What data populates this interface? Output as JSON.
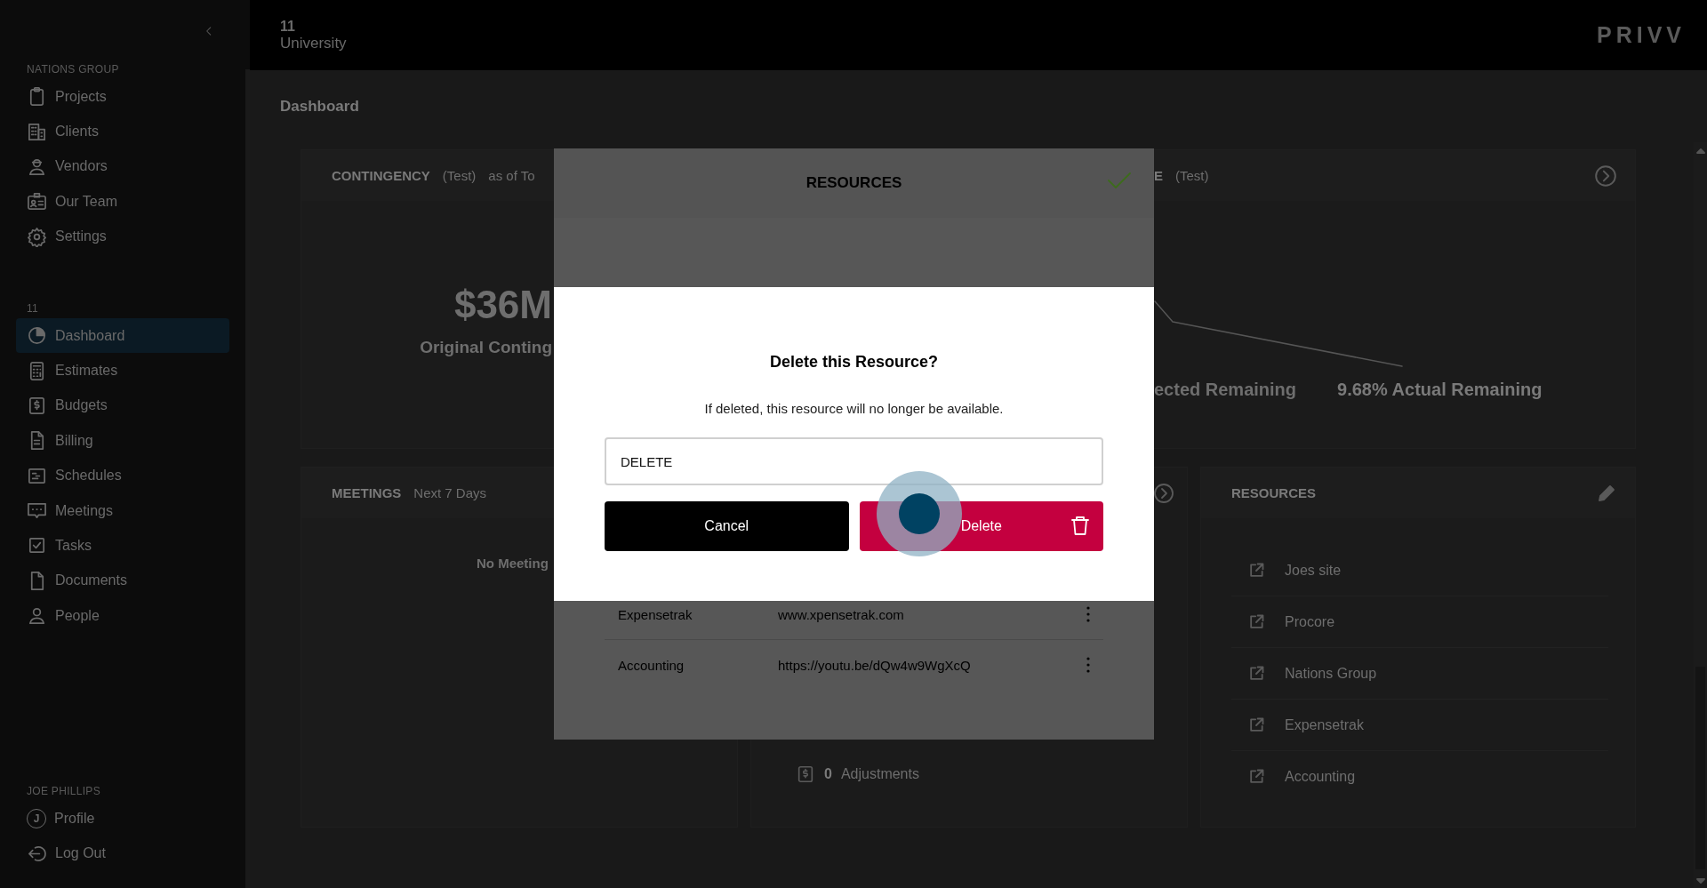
{
  "sidebar": {
    "sections": [
      {
        "title": "NATIONS GROUP",
        "items": [
          {
            "label": "Projects",
            "selected": false
          },
          {
            "label": "Clients",
            "selected": false
          },
          {
            "label": "Vendors",
            "selected": false
          },
          {
            "label": "Our Team",
            "selected": false
          },
          {
            "label": "Settings",
            "selected": false
          }
        ]
      },
      {
        "title": "11",
        "items": [
          {
            "label": "Dashboard",
            "selected": true
          },
          {
            "label": "Estimates",
            "selected": false
          },
          {
            "label": "Budgets",
            "selected": false
          },
          {
            "label": "Billing",
            "selected": false
          },
          {
            "label": "Schedules",
            "selected": false
          },
          {
            "label": "Meetings",
            "selected": false
          },
          {
            "label": "Tasks",
            "selected": false
          },
          {
            "label": "Documents",
            "selected": false
          },
          {
            "label": "People",
            "selected": false
          }
        ]
      },
      {
        "title": "JOE PHILLIPS",
        "items": [
          {
            "label": "Profile",
            "initial": "J",
            "selected": false
          },
          {
            "label": "Log Out",
            "selected": false
          }
        ]
      }
    ]
  },
  "header": {
    "project_number": "11",
    "project_name": "University",
    "logo": "PRIVV"
  },
  "page_title": "Dashboard",
  "contingency_card": {
    "title": "CONTINGENCY",
    "tag": "(Test)",
    "date": "as of To",
    "amount": "$36M",
    "amount_label": "Original Conting"
  },
  "second_card": {
    "title": "E",
    "tag": "(Test)",
    "stats": [
      "ected Remaining",
      "9.68% Actual Remaining"
    ]
  },
  "meetings_card": {
    "title": "MEETINGS",
    "range": "Next 7 Days",
    "empty_text": "No Meeting"
  },
  "adjustments_card": {
    "count": "0",
    "label": "Adjustments"
  },
  "resources_card": {
    "title": "RESOURCES",
    "items": [
      "Joes site",
      "Procore",
      "Nations Group",
      "Expensetrak",
      "Accounting"
    ]
  },
  "resources_modal": {
    "title": "RESOURCES",
    "rows": [
      {
        "name": "Expensetrak",
        "url": "www.xpensetrak.com"
      },
      {
        "name": "Accounting",
        "url": "https://youtu.be/dQw4w9WgXcQ"
      }
    ]
  },
  "delete_dialog": {
    "title": "Delete this Resource?",
    "message": "If deleted, this resource will no longer be available.",
    "input_value": "DELETE",
    "buttons": [
      {
        "label": "Cancel",
        "kind": "secondary"
      },
      {
        "label": "Delete",
        "kind": "danger"
      }
    ]
  }
}
